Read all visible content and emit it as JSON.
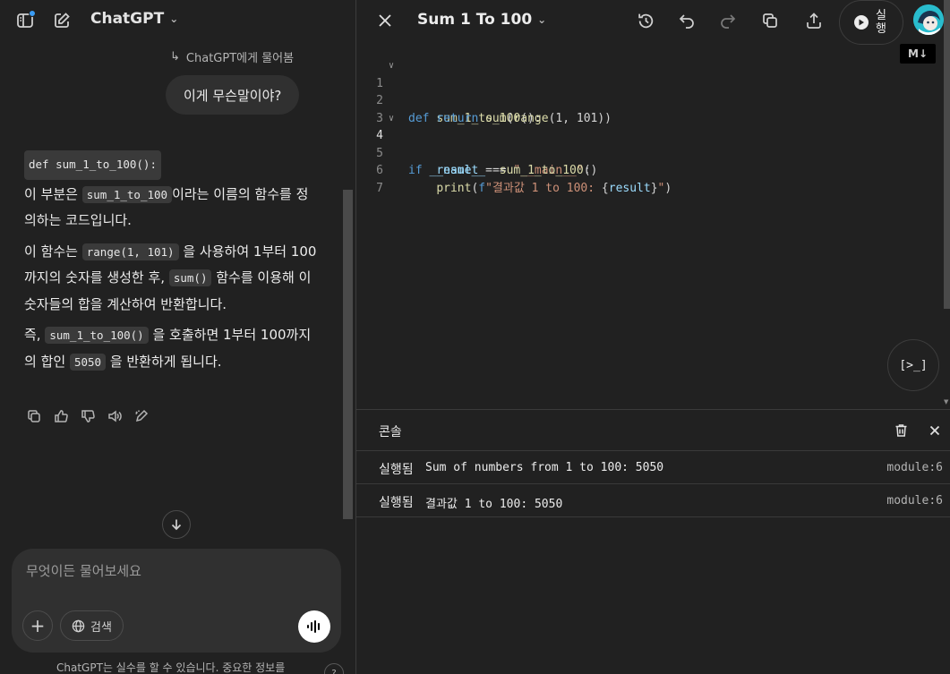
{
  "left": {
    "brand": "ChatGPT",
    "asked_label": "ChatGPT에게 물어봄",
    "user_message": "이게 무슨말이야?",
    "answer": {
      "header_code": "def sum_1_to_100():",
      "p1_pre": "이 부분은 ",
      "p1_code": "sum_1_to_100",
      "p1_post": "이라는 이름의 함수를 정의하는 코드입니다.",
      "p2_pre": "이 함수는 ",
      "p2_code1": "range(1, 101)",
      "p2_mid": " 을 사용하여 1부터 100까지의 숫자를 생성한 후, ",
      "p2_code2": "sum()",
      "p2_post": " 함수를 이용해 이 숫자들의 합을 계산하여 반환합니다.",
      "p3_pre": "즉, ",
      "p3_code1": "sum_1_to_100()",
      "p3_mid": " 을 호출하면 1부터 100까지의 합인 ",
      "p3_code2": "5050",
      "p3_post": " 을 반환하게 됩니다."
    },
    "composer": {
      "placeholder": "무엇이든 물어보세요",
      "search_label": "검색"
    },
    "disclaimer": "ChatGPT는 실수를 할 수 있습니다. 중요한 정보를",
    "help": "?"
  },
  "right": {
    "title": "Sum 1 To 100",
    "run_label": "실행",
    "md_badge": "M↓",
    "fab_label": "[>_]",
    "code": [
      {
        "n": "1",
        "fold": true
      },
      {
        "n": "2",
        "fold": false
      },
      {
        "n": "3",
        "fold": false
      },
      {
        "n": "4",
        "fold": true
      },
      {
        "n": "5",
        "fold": false
      },
      {
        "n": "6",
        "fold": false
      },
      {
        "n": "7",
        "fold": false
      }
    ],
    "console": {
      "title": "콘솔",
      "rows": [
        {
          "status": "실행됨",
          "message": "Sum of numbers from 1 to 100: 5050",
          "source": "module:6"
        },
        {
          "status": "실행됨",
          "message": "결과값 1 to 100: 5050",
          "source": "module:6"
        }
      ]
    }
  }
}
